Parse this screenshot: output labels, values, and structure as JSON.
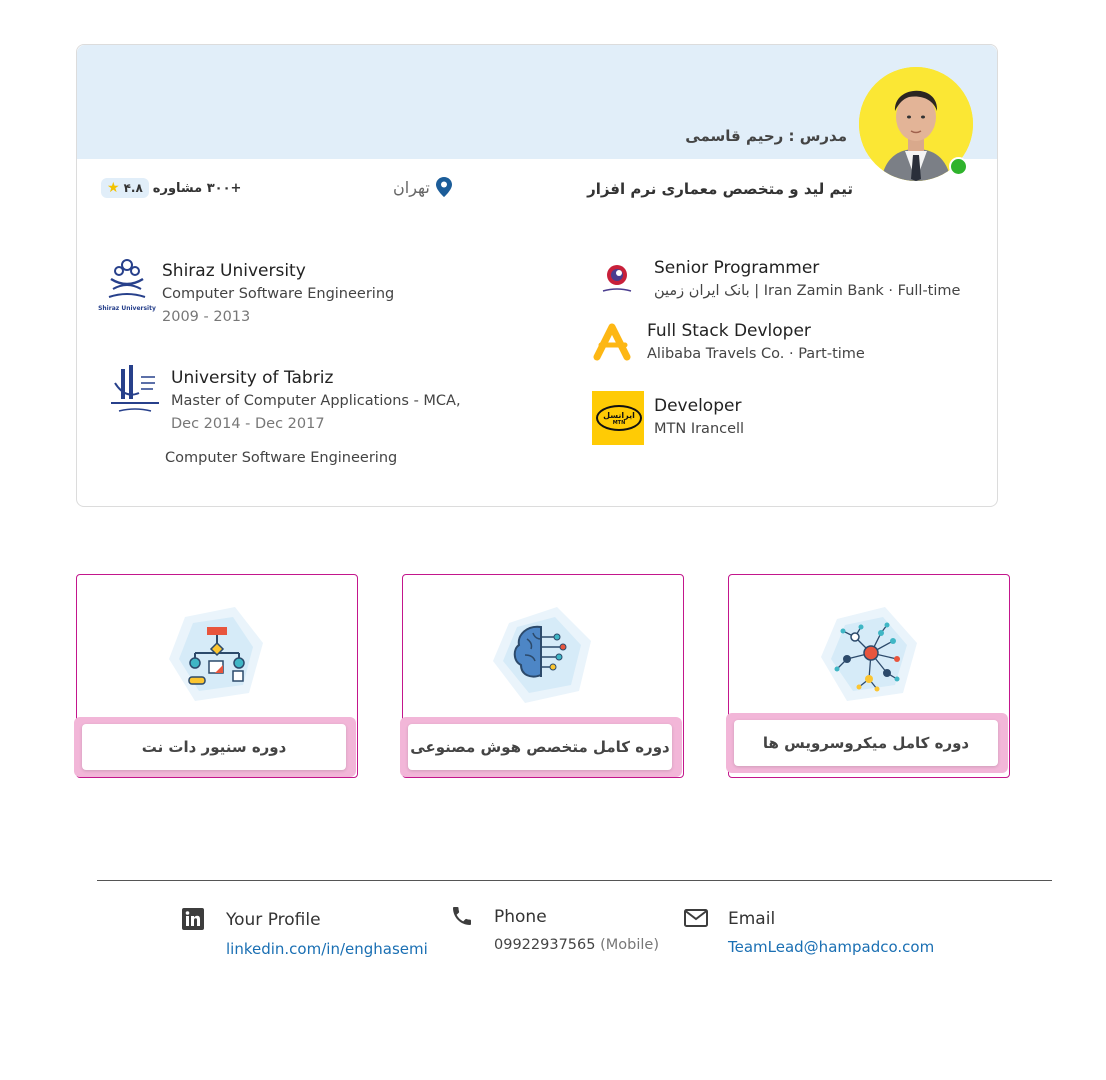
{
  "profile": {
    "teacher_label": "مدرس : رحیم قاسمی",
    "headline": "تیم لید و متخصص معماری نرم افزار",
    "location": "تهران",
    "consultations": "+۳۰۰ مشاوره",
    "rating": "۴.۸"
  },
  "experience": [
    {
      "title": "Senior Programmer",
      "company": "بانک ایران زمین | Iran Zamin Bank · Full-time"
    },
    {
      "title": "Full Stack Devloper",
      "company": "Alibaba Travels Co. · Part-time"
    },
    {
      "title": "Developer",
      "company": "MTN Irancell"
    }
  ],
  "education": [
    {
      "school": "Shiraz University",
      "degree": "Computer Software Engineering",
      "dates": "2009 - 2013",
      "logo_text": "Shiraz University"
    },
    {
      "school": "University of Tabriz",
      "degree": "Master of Computer Applications - MCA,",
      "dates": "Dec 2014 - Dec 2017",
      "field": "Computer Software Engineering"
    }
  ],
  "logos": {
    "mtn_text": "ایرانسل",
    "mtn_sub": "MTN"
  },
  "courses": [
    {
      "label": "دوره سنیور دات نت",
      "icon": "flowchart-icon"
    },
    {
      "label": "دوره کامل متخصص هوش مصنوعی",
      "icon": "brain-icon"
    },
    {
      "label": "دوره کامل میکروسرویس ها",
      "icon": "network-icon"
    }
  ],
  "footer": {
    "linkedin_title": "Your Profile",
    "linkedin_link": "linkedin.com/in/enghasemi",
    "phone_title": "Phone",
    "phone_number": "09922937565",
    "phone_type": "(Mobile)",
    "email_title": "Email",
    "email_address": "TeamLead@hampadco.com"
  },
  "colors": {
    "banner": "#e1eef9",
    "course_border": "#c3168c",
    "course_accent": "#f2b6d8",
    "link": "#1a6fb3",
    "online": "#2fb32c"
  }
}
